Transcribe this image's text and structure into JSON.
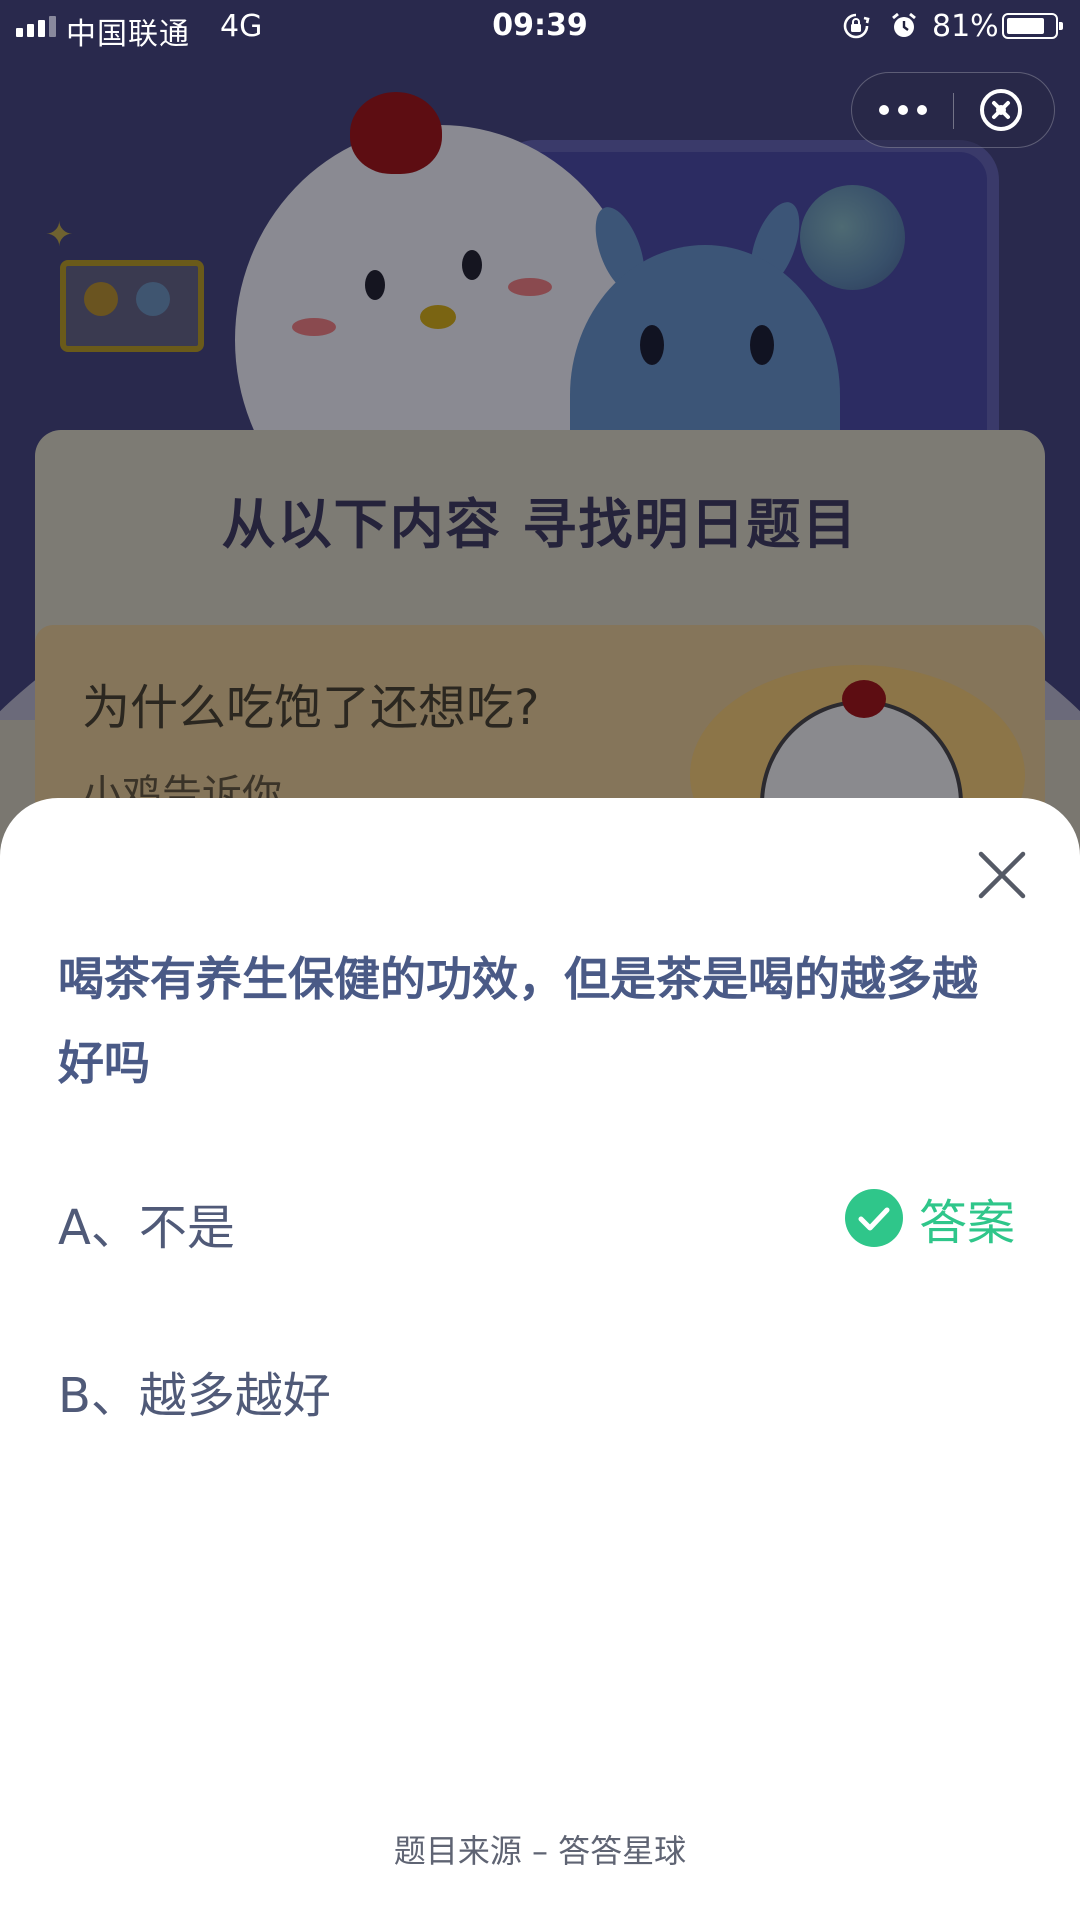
{
  "status_bar": {
    "carrier": "中国联通",
    "network": "4G",
    "time": "09:39",
    "battery_percent": "81%",
    "battery_level": 0.81
  },
  "capsule": {
    "more_icon": "more-dots-icon",
    "close_icon": "circle-close-icon"
  },
  "background": {
    "headline": "从以下内容  寻找明日题目",
    "article_title": "为什么吃饱了还想吃?",
    "article_subtitle": "小鸡告诉你"
  },
  "sheet": {
    "question": "喝茶有养生保健的功效，但是茶是喝的越多越好吗",
    "options": [
      {
        "label": "A、不是",
        "is_answer": true
      },
      {
        "label": "B、越多越好",
        "is_answer": false
      }
    ],
    "answer_label": "答案",
    "source": "题目来源 – 答答星球"
  },
  "colors": {
    "question_text": "#4a5a86",
    "option_text": "#505a78",
    "answer_green": "#2fc68a"
  }
}
